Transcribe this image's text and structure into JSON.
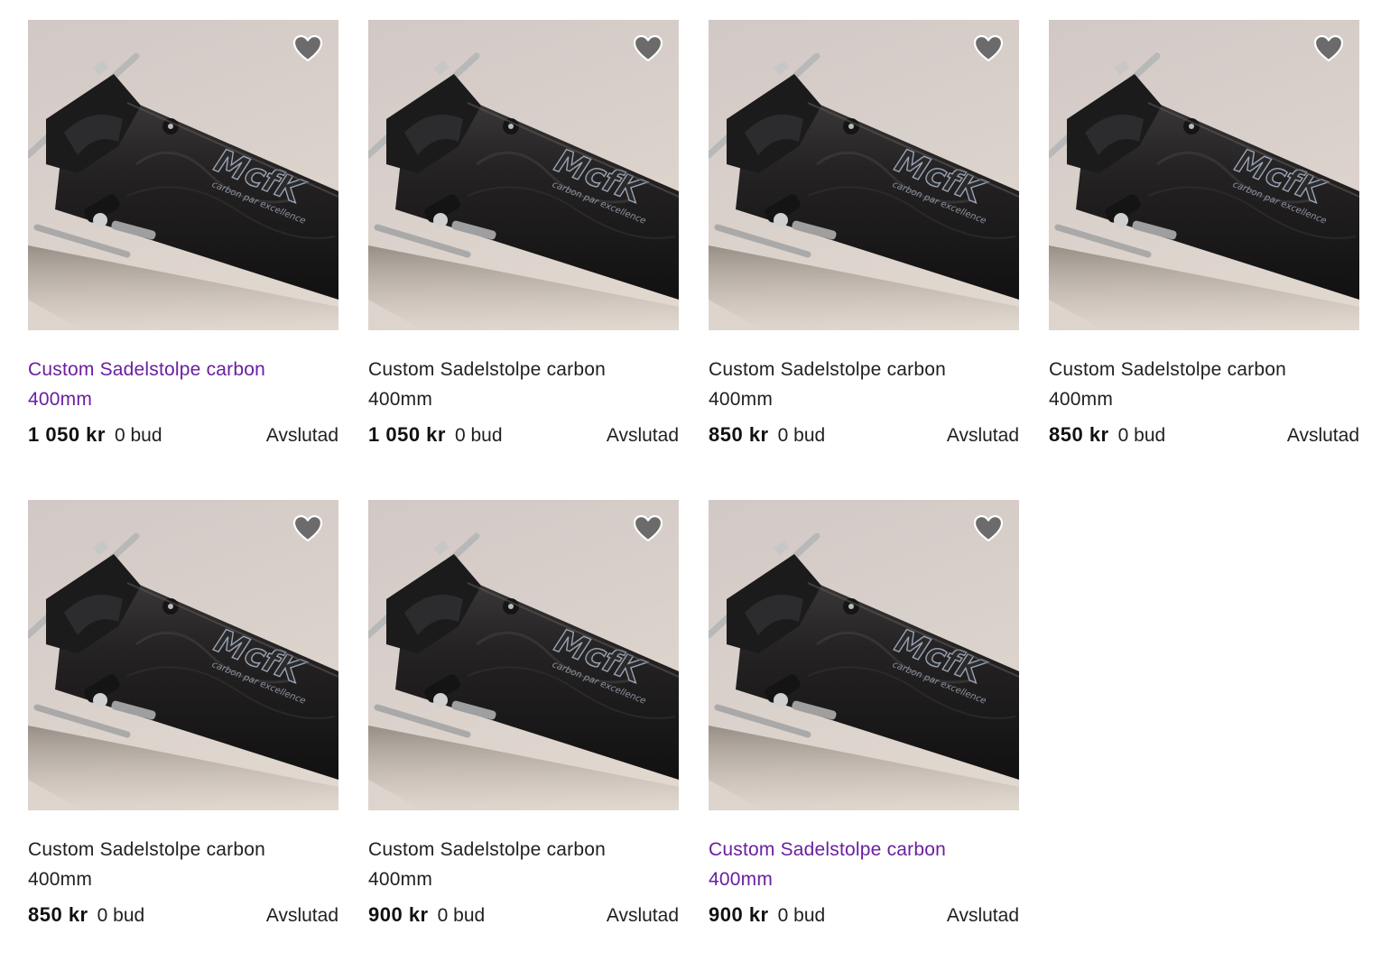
{
  "listings": [
    {
      "title_line1": "Custom Sadelstolpe carbon",
      "title_line2": "400mm",
      "price": "1 050 kr",
      "bids": "0 bud",
      "status": "Avslutad",
      "visited": true
    },
    {
      "title_line1": "Custom Sadelstolpe carbon",
      "title_line2": "400mm",
      "price": "1 050 kr",
      "bids": "0 bud",
      "status": "Avslutad",
      "visited": false
    },
    {
      "title_line1": "Custom Sadelstolpe carbon",
      "title_line2": "400mm",
      "price": "850 kr",
      "bids": "0 bud",
      "status": "Avslutad",
      "visited": false
    },
    {
      "title_line1": "Custom Sadelstolpe carbon",
      "title_line2": "400mm",
      "price": "850 kr",
      "bids": "0 bud",
      "status": "Avslutad",
      "visited": false
    },
    {
      "title_line1": "Custom Sadelstolpe carbon",
      "title_line2": "400mm",
      "price": "850 kr",
      "bids": "0 bud",
      "status": "Avslutad",
      "visited": false
    },
    {
      "title_line1": "Custom Sadelstolpe carbon",
      "title_line2": "400mm",
      "price": "900 kr",
      "bids": "0 bud",
      "status": "Avslutad",
      "visited": false
    },
    {
      "title_line1": "Custom Sadelstolpe carbon",
      "title_line2": "400mm",
      "price": "900 kr",
      "bids": "0 bud",
      "status": "Avslutad",
      "visited": true
    }
  ],
  "favorite_icon": "heart-icon",
  "colors": {
    "visited_link": "#6a1fa0",
    "text": "#1f1f1f",
    "heart_fill": "#6b6b6b"
  }
}
